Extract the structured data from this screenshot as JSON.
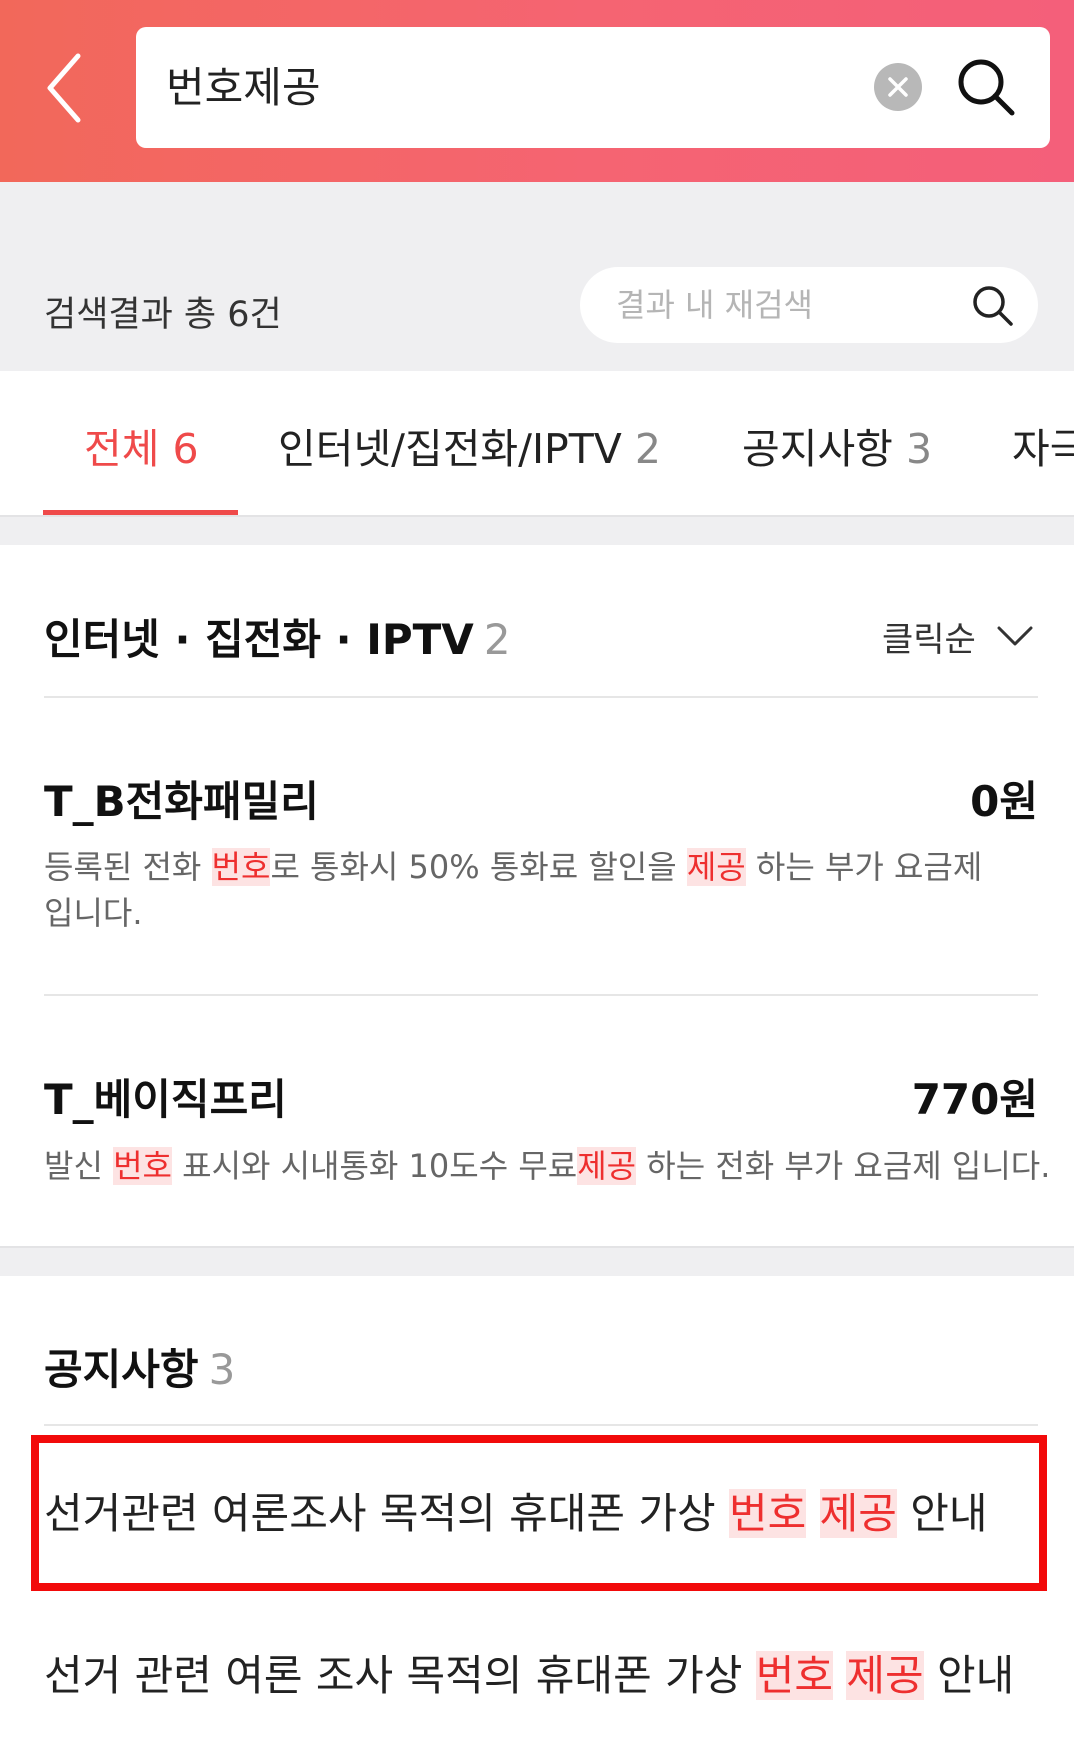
{
  "header": {
    "search_value": "번호제공",
    "icons": {
      "back": "chevron-left-icon",
      "clear": "close-circle-icon",
      "search": "search-icon"
    }
  },
  "results": {
    "count_text": "검색결과 총 6건",
    "re_search_placeholder": "결과 내 재검색"
  },
  "tabs": [
    {
      "label": "전체",
      "count": "6",
      "active": true
    },
    {
      "label": "인터넷/집전화/IPTV",
      "count": "2",
      "active": false
    },
    {
      "label": "공지사항",
      "count": "3",
      "active": false
    },
    {
      "label": "자극",
      "count": "",
      "active": false
    }
  ],
  "internet_section": {
    "title": "인터넷 · 집전화 · IPTV",
    "count": "2",
    "sort_label": "클릭순",
    "items": [
      {
        "name": "T_B전화패밀리",
        "price": "0원",
        "desc": [
          {
            "text": "등록된 전화 ",
            "hl": false
          },
          {
            "text": "번호",
            "hl": true
          },
          {
            "text": "로 통화시 50% 통화료 할인을 ",
            "hl": false
          },
          {
            "text": "제공",
            "hl": true
          },
          {
            "text": " 하는 부가 요금제 입니다.",
            "hl": false
          }
        ]
      },
      {
        "name": "T_베이직프리",
        "price": "770원",
        "desc": [
          {
            "text": "발신 ",
            "hl": false
          },
          {
            "text": "번호",
            "hl": true
          },
          {
            "text": " 표시와 시내통화 10도수 무료",
            "hl": false
          },
          {
            "text": "제공",
            "hl": true
          },
          {
            "text": " 하는 전화 부가 요금제 입니다.",
            "hl": false
          }
        ]
      }
    ]
  },
  "notice_section": {
    "title": "공지사항",
    "count": "3",
    "items": [
      [
        {
          "text": "선거관련 여론조사 목적의 휴대폰 가상 ",
          "hl": false
        },
        {
          "text": "번호",
          "hl": true
        },
        {
          "text": " ",
          "hl": false
        },
        {
          "text": "제공",
          "hl": true
        },
        {
          "text": " 안내",
          "hl": false
        }
      ],
      [
        {
          "text": "선거 관련 여론 조사 목적의 휴대폰 가상 ",
          "hl": false
        },
        {
          "text": "번호",
          "hl": true
        },
        {
          "text": " ",
          "hl": false
        },
        {
          "text": "제공",
          "hl": true
        },
        {
          "text": " 안내",
          "hl": false
        }
      ]
    ]
  },
  "colors": {
    "accent": "#ef4a4a",
    "highlight_text": "#ee2f2f",
    "highlight_bg": "#fde3e3",
    "annotation_box": "#f20a0a"
  }
}
